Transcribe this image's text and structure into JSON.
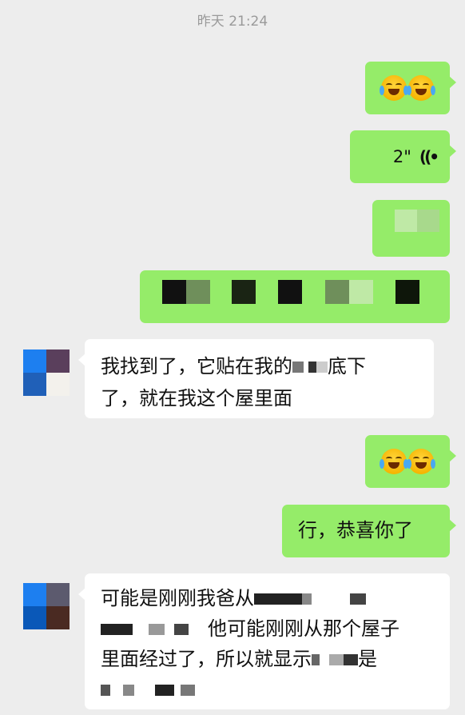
{
  "chat": {
    "timestamp": "昨天 21:24",
    "messages": [
      {
        "side": "right",
        "type": "emoji",
        "emojis": [
          "face-with-tears-of-joy",
          "face-with-tears-of-joy"
        ]
      },
      {
        "side": "right",
        "type": "voice",
        "duration": "2\""
      },
      {
        "side": "right",
        "type": "obscured-image"
      },
      {
        "side": "right",
        "type": "obscured-image"
      },
      {
        "side": "left",
        "type": "text",
        "lines": [
          "我找到了，它贴在我的",
          "底下",
          "了，就在我这个屋里面"
        ]
      },
      {
        "side": "right",
        "type": "emoji",
        "emojis": [
          "face-with-tears-of-joy",
          "face-with-tears-of-joy"
        ]
      },
      {
        "side": "right",
        "type": "text",
        "text": "行，恭喜你了"
      },
      {
        "side": "left",
        "type": "text",
        "lines": [
          "可能是刚刚我爸从",
          "他可能刚刚从那个屋子",
          "里面经过了，所以就显示",
          "是"
        ]
      }
    ]
  },
  "colors": {
    "outgoing_bubble": "#95ec69",
    "incoming_bubble": "#ffffff",
    "background": "#ededed"
  }
}
